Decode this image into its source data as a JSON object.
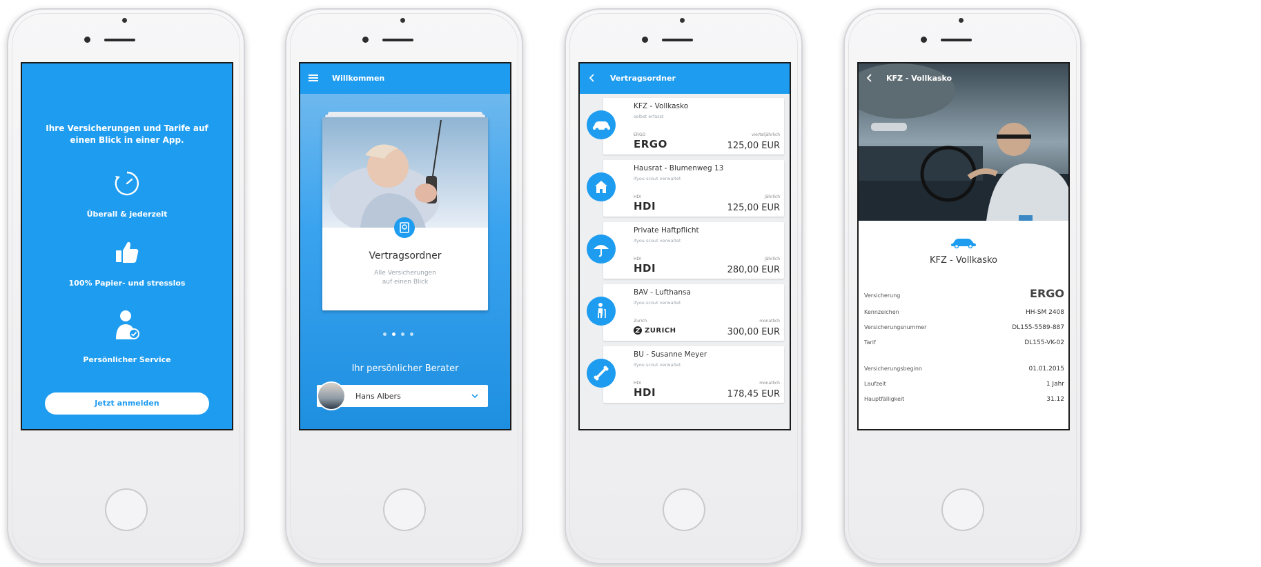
{
  "onboarding": {
    "headline": "Ihre Versicherungen und Tarife auf\neinen Blick in einer App.",
    "feature_1": "Überall & jederzeit",
    "feature_2": "100% Papier- und stresslos",
    "feature_3": "Persönlicher Service",
    "cta": "Jetzt anmelden"
  },
  "welcome": {
    "title": "Willkommen",
    "card_title": "Vertragsordner",
    "card_subtitle": "Alle Versicherungen\nauf einen Blick",
    "advisor_heading": "Ihr persönlicher Berater",
    "advisor_name": "Hans Albers"
  },
  "contracts": {
    "title": "Vertragsordner",
    "items": [
      {
        "icon": "car-icon",
        "title": "KFZ - Vollkasko",
        "subtitle": "selbst erfasst",
        "insurer_label": "ERGO",
        "insurer": "ERGO",
        "period": "vierteljährlich",
        "amount": "125,00 EUR"
      },
      {
        "icon": "house-icon",
        "title": "Hausrat - Blumenweg 13",
        "subtitle": "ifyou scout verwaltet",
        "insurer_label": "HDI",
        "insurer": "HDI",
        "period": "Jährlich",
        "amount": "125,00 EUR"
      },
      {
        "icon": "umbrella-icon",
        "title": "Private Haftpflicht",
        "subtitle": "ifyou scout verwaltet",
        "insurer_label": "HDI",
        "insurer": "HDI",
        "period": "Jährlich",
        "amount": "280,00 EUR"
      },
      {
        "icon": "cane-person-icon",
        "title": "BAV - Lufthansa",
        "subtitle": "ifyou scout verwaltet",
        "insurer_label": "Zurich",
        "insurer": "ZURICH",
        "period": "monatlich",
        "amount": "300,00 EUR"
      },
      {
        "icon": "bone-icon",
        "title": "BU - Susanne Meyer",
        "subtitle": "ifyou scout verwaltet",
        "insurer_label": "HDI",
        "insurer": "HDI",
        "period": "monatlich",
        "amount": "178,45 EUR"
      }
    ]
  },
  "detail": {
    "header": "KFZ - Vollkasko",
    "title": "KFZ - Vollkasko",
    "rows": [
      {
        "key": "Versicherung",
        "value": "ERGO"
      },
      {
        "key": "Kennzeichen",
        "value": "HH-SM 2408"
      },
      {
        "key": "Versicherungsnummer",
        "value": "DL155-5589-887"
      },
      {
        "key": "Tarif",
        "value": "DL155-VK-02"
      },
      {
        "key": "Versicherungsbeginn",
        "value": "01.01.2015"
      },
      {
        "key": "Laufzeit",
        "value": "1 Jahr"
      },
      {
        "key": "Hauptfälligkeit",
        "value": "31.12"
      }
    ]
  },
  "colors": {
    "accent": "#1e9cf0",
    "page_bg": "#ffffff",
    "list_bg": "#eeeff1"
  }
}
